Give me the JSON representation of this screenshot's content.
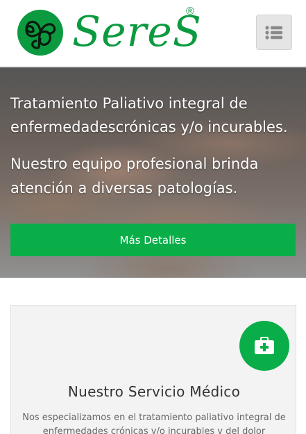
{
  "header": {
    "logo_text": "SereS",
    "logo_registered": "®",
    "menu_icon": "list-menu-icon",
    "brand_color": "#0b9a3f"
  },
  "hero": {
    "heading": "Tratamiento Paliativo integral de enfermedadescrónicas y/o incurables.",
    "subheading": "Nuestro equipo profesional brinda atención a diversas patologías.",
    "button_label": "Más Detalles",
    "accent_color": "#0aae49"
  },
  "service_card": {
    "icon": "first-aid-kit-icon",
    "title": "Nuestro Servicio Médico",
    "description": "Nos especializamos en el tratamiento paliativo integral de enfermedades crónicas y/o incurables y del dolor"
  }
}
